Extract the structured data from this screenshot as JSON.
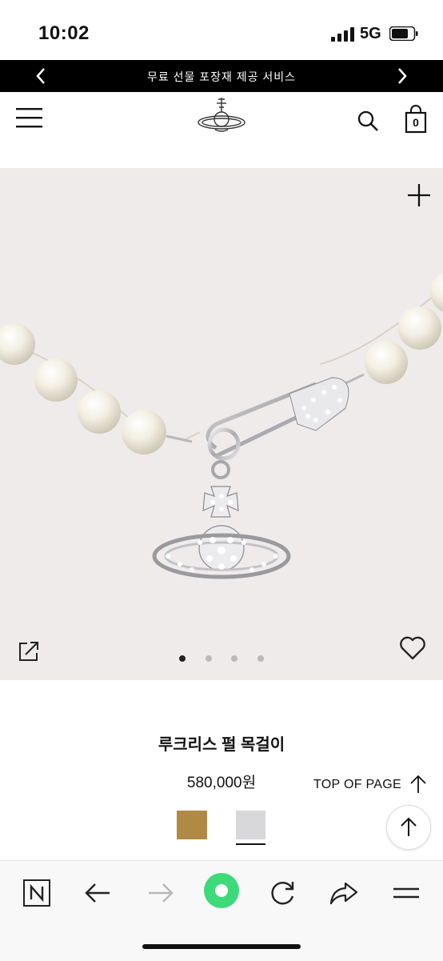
{
  "status_bar": {
    "time": "10:02",
    "network": "5G"
  },
  "promo_bar": {
    "text": "무료 선물 포장재 제공 서비스"
  },
  "product": {
    "name": "루크리스 펄 목걸이",
    "price": "580,000원"
  },
  "cart": {
    "count": "0"
  },
  "top_of_page": {
    "label": "TOP OF PAGE"
  },
  "carousel": {
    "total": 4,
    "active": 1
  },
  "swatches": [
    {
      "name": "gold",
      "color": "#b08a45"
    },
    {
      "name": "silver",
      "color": "#d8d8db",
      "selected": true
    }
  ],
  "colors": {
    "accent_green": "#3dd97a",
    "promo_bg": "#000000",
    "hero_bg": "#efebeb"
  }
}
